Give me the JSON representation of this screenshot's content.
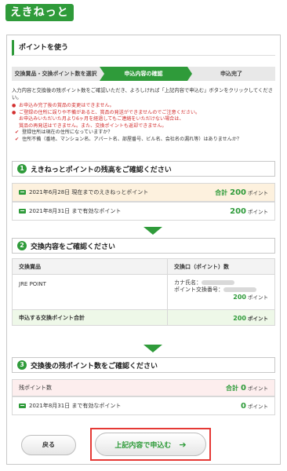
{
  "header": {
    "logo": "えきねっと"
  },
  "page": {
    "title": "ポイントを使う"
  },
  "steps": [
    {
      "label": "交換賞品・交換ポイント数を選択"
    },
    {
      "label": "申込内容の確認"
    },
    {
      "label": "申込完了"
    }
  ],
  "intro": "入力内容と交換後の残ポイント数をご確認いただき、よろしければ「上記内容で申込む」ボタンをクリックしてください。",
  "notes": [
    "お申込み完了後の賞品の変更はできません。",
    "ご登録の住所に誤りや不備があると、賞品の発送ができませんのでご注意ください。",
    "お申込みいただいた月より6ヶ月を経過してもご連絡をいただけない場合は、",
    "賞品の再発送はできません。また、交換ポイントも返却できません。",
    "登録住所は現在の住所になっていますか？",
    "住所不備（番地、マンション名、アパート名、部屋番号、ビル名、会社名の漏れ等）はありませんか？"
  ],
  "section1": {
    "num": "1",
    "title": "えきねっとポイントの残高をご確認ください",
    "row1_label": "2021年6月28日 現在までのえきねっとポイント",
    "row1_total_label": "合計",
    "row1_value": "200",
    "row2_label": "2021年8月31日 まで有効なポイント",
    "row2_value": "200",
    "unit": "ポイント"
  },
  "section2": {
    "num": "2",
    "title": "交換内容をご確認ください",
    "col1": "交換賞品",
    "col2": "交換口（ポイント）数",
    "product": "JRE POINT",
    "kana_label": "カナ氏名：",
    "pts_label": "ポイント交換番号：",
    "points": "200",
    "sum_label": "申込する交換ポイント合計",
    "sum_value": "200",
    "unit": "ポイント"
  },
  "section3": {
    "num": "3",
    "title": "交換後の残ポイント数をご確認ください",
    "row1_label": "残ポイント数",
    "row1_total_label": "合計",
    "row1_value": "0",
    "row2_label": "2021年8月31日 まで有効なポイント",
    "row2_value": "0",
    "unit": "ポイント"
  },
  "buttons": {
    "back": "戻る",
    "submit": "上記内容で申込む",
    "submit_arrow": "➔"
  },
  "colors": {
    "brand": "#2f9b3a",
    "alert": "#d32f2f",
    "highlight_border": "#e53935"
  }
}
